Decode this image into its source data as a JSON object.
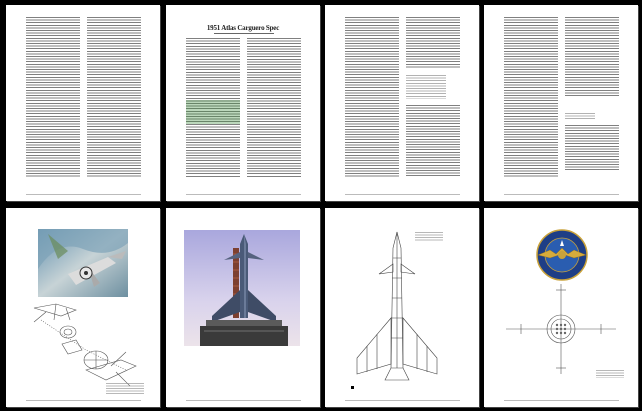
{
  "viewer": {
    "pages": [
      {
        "index": 1,
        "kind": "text"
      },
      {
        "index": 2,
        "kind": "text",
        "title": "1951 Atlas Carguero Spec"
      },
      {
        "index": 3,
        "kind": "text"
      },
      {
        "index": 4,
        "kind": "text"
      },
      {
        "index": 5,
        "kind": "illustration",
        "subject": "spaceship-photo-and-exploded-diagram"
      },
      {
        "index": 6,
        "kind": "photo",
        "subject": "rocket-on-launch-tower"
      },
      {
        "index": 7,
        "kind": "line-drawing",
        "subject": "rocket-blueprint"
      },
      {
        "index": 8,
        "kind": "emblem",
        "subject": "national-council-of-astronautics-seal"
      }
    ],
    "emblem_text": "NATIONAL COUNCIL ASTRONAUTICS"
  }
}
